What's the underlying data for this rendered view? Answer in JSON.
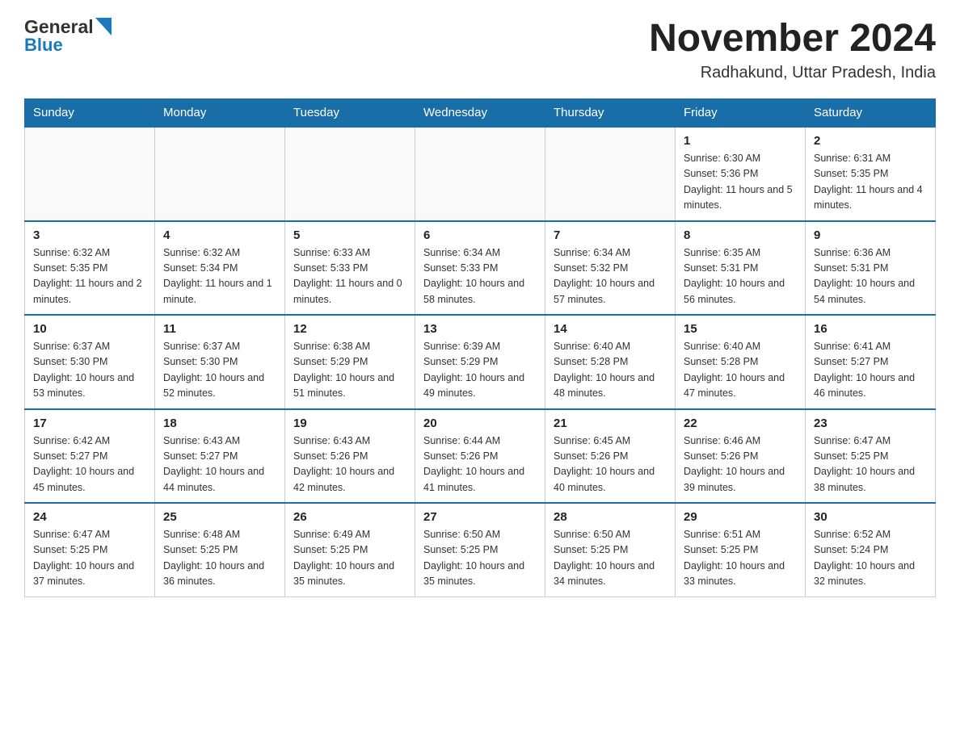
{
  "header": {
    "logo_general": "General",
    "logo_blue": "Blue",
    "month_title": "November 2024",
    "location": "Radhakund, Uttar Pradesh, India"
  },
  "weekdays": [
    "Sunday",
    "Monday",
    "Tuesday",
    "Wednesday",
    "Thursday",
    "Friday",
    "Saturday"
  ],
  "weeks": [
    [
      {
        "day": "",
        "info": ""
      },
      {
        "day": "",
        "info": ""
      },
      {
        "day": "",
        "info": ""
      },
      {
        "day": "",
        "info": ""
      },
      {
        "day": "",
        "info": ""
      },
      {
        "day": "1",
        "info": "Sunrise: 6:30 AM\nSunset: 5:36 PM\nDaylight: 11 hours and 5 minutes."
      },
      {
        "day": "2",
        "info": "Sunrise: 6:31 AM\nSunset: 5:35 PM\nDaylight: 11 hours and 4 minutes."
      }
    ],
    [
      {
        "day": "3",
        "info": "Sunrise: 6:32 AM\nSunset: 5:35 PM\nDaylight: 11 hours and 2 minutes."
      },
      {
        "day": "4",
        "info": "Sunrise: 6:32 AM\nSunset: 5:34 PM\nDaylight: 11 hours and 1 minute."
      },
      {
        "day": "5",
        "info": "Sunrise: 6:33 AM\nSunset: 5:33 PM\nDaylight: 11 hours and 0 minutes."
      },
      {
        "day": "6",
        "info": "Sunrise: 6:34 AM\nSunset: 5:33 PM\nDaylight: 10 hours and 58 minutes."
      },
      {
        "day": "7",
        "info": "Sunrise: 6:34 AM\nSunset: 5:32 PM\nDaylight: 10 hours and 57 minutes."
      },
      {
        "day": "8",
        "info": "Sunrise: 6:35 AM\nSunset: 5:31 PM\nDaylight: 10 hours and 56 minutes."
      },
      {
        "day": "9",
        "info": "Sunrise: 6:36 AM\nSunset: 5:31 PM\nDaylight: 10 hours and 54 minutes."
      }
    ],
    [
      {
        "day": "10",
        "info": "Sunrise: 6:37 AM\nSunset: 5:30 PM\nDaylight: 10 hours and 53 minutes."
      },
      {
        "day": "11",
        "info": "Sunrise: 6:37 AM\nSunset: 5:30 PM\nDaylight: 10 hours and 52 minutes."
      },
      {
        "day": "12",
        "info": "Sunrise: 6:38 AM\nSunset: 5:29 PM\nDaylight: 10 hours and 51 minutes."
      },
      {
        "day": "13",
        "info": "Sunrise: 6:39 AM\nSunset: 5:29 PM\nDaylight: 10 hours and 49 minutes."
      },
      {
        "day": "14",
        "info": "Sunrise: 6:40 AM\nSunset: 5:28 PM\nDaylight: 10 hours and 48 minutes."
      },
      {
        "day": "15",
        "info": "Sunrise: 6:40 AM\nSunset: 5:28 PM\nDaylight: 10 hours and 47 minutes."
      },
      {
        "day": "16",
        "info": "Sunrise: 6:41 AM\nSunset: 5:27 PM\nDaylight: 10 hours and 46 minutes."
      }
    ],
    [
      {
        "day": "17",
        "info": "Sunrise: 6:42 AM\nSunset: 5:27 PM\nDaylight: 10 hours and 45 minutes."
      },
      {
        "day": "18",
        "info": "Sunrise: 6:43 AM\nSunset: 5:27 PM\nDaylight: 10 hours and 44 minutes."
      },
      {
        "day": "19",
        "info": "Sunrise: 6:43 AM\nSunset: 5:26 PM\nDaylight: 10 hours and 42 minutes."
      },
      {
        "day": "20",
        "info": "Sunrise: 6:44 AM\nSunset: 5:26 PM\nDaylight: 10 hours and 41 minutes."
      },
      {
        "day": "21",
        "info": "Sunrise: 6:45 AM\nSunset: 5:26 PM\nDaylight: 10 hours and 40 minutes."
      },
      {
        "day": "22",
        "info": "Sunrise: 6:46 AM\nSunset: 5:26 PM\nDaylight: 10 hours and 39 minutes."
      },
      {
        "day": "23",
        "info": "Sunrise: 6:47 AM\nSunset: 5:25 PM\nDaylight: 10 hours and 38 minutes."
      }
    ],
    [
      {
        "day": "24",
        "info": "Sunrise: 6:47 AM\nSunset: 5:25 PM\nDaylight: 10 hours and 37 minutes."
      },
      {
        "day": "25",
        "info": "Sunrise: 6:48 AM\nSunset: 5:25 PM\nDaylight: 10 hours and 36 minutes."
      },
      {
        "day": "26",
        "info": "Sunrise: 6:49 AM\nSunset: 5:25 PM\nDaylight: 10 hours and 35 minutes."
      },
      {
        "day": "27",
        "info": "Sunrise: 6:50 AM\nSunset: 5:25 PM\nDaylight: 10 hours and 35 minutes."
      },
      {
        "day": "28",
        "info": "Sunrise: 6:50 AM\nSunset: 5:25 PM\nDaylight: 10 hours and 34 minutes."
      },
      {
        "day": "29",
        "info": "Sunrise: 6:51 AM\nSunset: 5:25 PM\nDaylight: 10 hours and 33 minutes."
      },
      {
        "day": "30",
        "info": "Sunrise: 6:52 AM\nSunset: 5:24 PM\nDaylight: 10 hours and 32 minutes."
      }
    ]
  ]
}
